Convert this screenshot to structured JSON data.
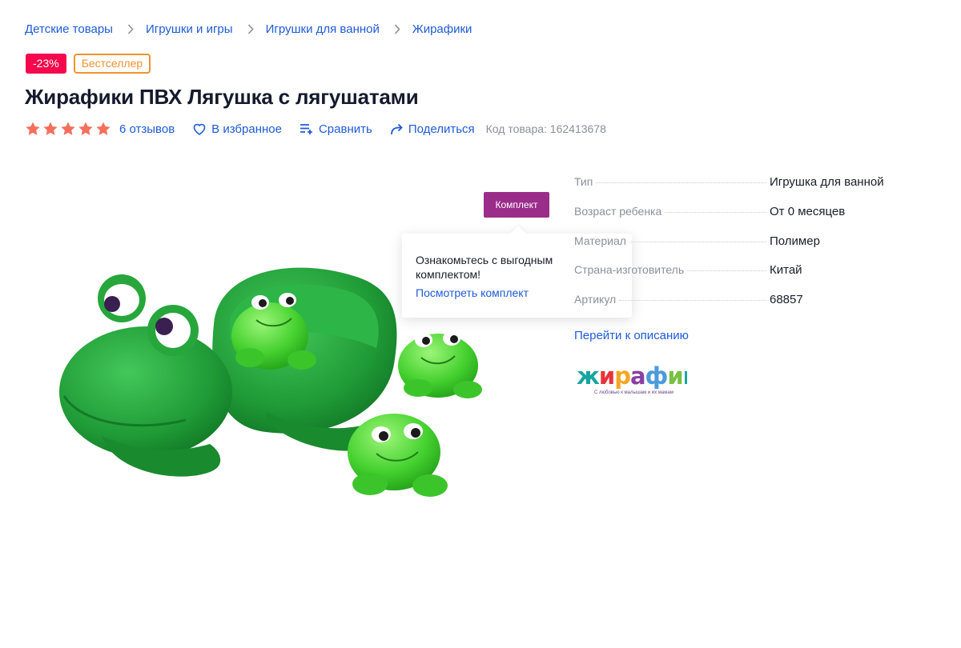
{
  "breadcrumbs": [
    "Детские товары",
    "Игрушки и игры",
    "Игрушки для ванной",
    "Жирафики"
  ],
  "badges": {
    "sale": "-23%",
    "bestseller": "Бестселлер"
  },
  "product": {
    "title": "Жирафики ПВХ Лягушка с лягушатами",
    "rating": 5,
    "reviews": "6 отзывов",
    "favorite": "В избранное",
    "compare": "Сравнить",
    "share": "Поделиться",
    "sku": "Код товара: 162413678"
  },
  "gallery": {
    "kit_label": "Комплект",
    "popover_text": "Ознакомьтесь с выгодным комплектом!",
    "popover_link": "Посмотреть комплект"
  },
  "specs": [
    {
      "name": "Тип",
      "value": "Игрушка для ванной"
    },
    {
      "name": "Возраст ребенка",
      "value": "От 0 месяцев"
    },
    {
      "name": "Материал",
      "value": "Полимер"
    },
    {
      "name": "Страна-изготовитель",
      "value": "Китай"
    },
    {
      "name": "Артикул",
      "value": "68857"
    }
  ],
  "description_link": "Перейти к описанию",
  "brand": {
    "name": "жирафики",
    "tagline": "С любовью к малышам и их мамам"
  },
  "colors": {
    "link": "#1e5bd6",
    "sale": "#f5084d",
    "bestseller": "#f3922c",
    "kit": "#9b2d8a",
    "star": "#f56f5c"
  }
}
